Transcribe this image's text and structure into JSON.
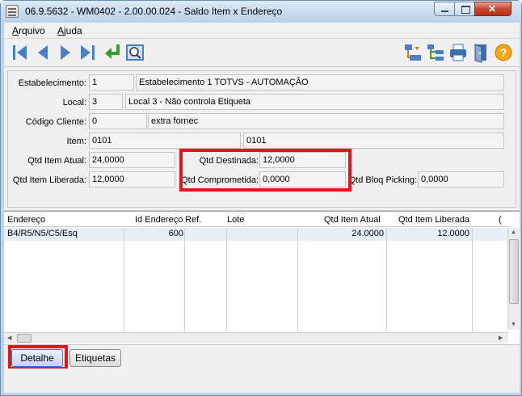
{
  "window": {
    "title": "06.9.5632 - WM0402 - 2.00.00.024 - Saldo Item x Endereço"
  },
  "menu": {
    "items": [
      "Arquivo",
      "Ajuda"
    ]
  },
  "toolbar": {
    "nav": [
      "first-record-icon",
      "previous-record-icon",
      "next-record-icon",
      "last-record-icon",
      "return-icon",
      "search-zoom-icon"
    ],
    "actions": [
      "structure-icon",
      "tree-list-icon",
      "printer-icon",
      "exit-door-icon",
      "help-icon"
    ]
  },
  "form": {
    "estabelecimento": {
      "label": "Estabelecimento:",
      "code": "1",
      "description": "Estabelecimento 1 TOTVS - AUTOMAÇÃO"
    },
    "local": {
      "label": "Local:",
      "code": "3",
      "description": "Local 3 - Não controla Etiqueta"
    },
    "cliente": {
      "label": "Código Cliente:",
      "code": "0",
      "description": "extra fornec"
    },
    "item": {
      "label": "Item:",
      "code": "0101",
      "description": "0101"
    },
    "qtd_item_atual": {
      "label": "Qtd Item Atual:",
      "value": "24,0000"
    },
    "qtd_destinada": {
      "label": "Qtd Destinada:",
      "value": "12,0000"
    },
    "qtd_item_liberada": {
      "label": "Qtd Item Liberada:",
      "value": "12,0000"
    },
    "qtd_comprometida": {
      "label": "Qtd Comprometida:",
      "value": "0,0000"
    },
    "qtd_bloq_picking": {
      "label": "Qtd Bloq Picking:",
      "value": "0,0000"
    }
  },
  "grid": {
    "columns": [
      "Endereço",
      "Id Endereço",
      "Ref.",
      "Lote",
      "Qtd Item Atual",
      "Qtd Item Liberada",
      "("
    ],
    "rows": [
      {
        "endereco": "B4/R5/N5/C5/Esq",
        "id_endereco": "600",
        "ref": "",
        "lote": "",
        "qtd_item_atual": "24.0000",
        "qtd_item_liberada": "12.0000"
      }
    ]
  },
  "buttons": {
    "detalhe": "Detalhe",
    "etiquetas": "Etiquetas"
  },
  "colors": {
    "highlight": "#e8141c",
    "title_bg": "#bfd3ea",
    "row_selected": "#e8eef8"
  }
}
